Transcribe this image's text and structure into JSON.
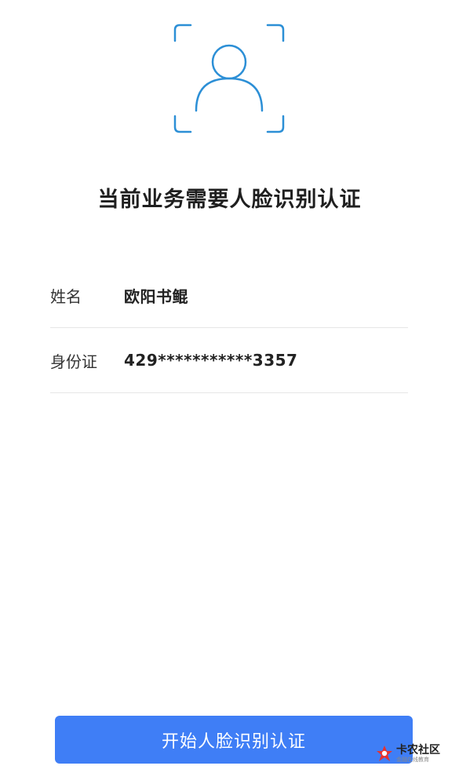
{
  "page": {
    "title": "当前业务需要人脸识别认证"
  },
  "face_icon": {
    "name": "face-scan-icon",
    "color": "#2c8fd6"
  },
  "info": {
    "rows": [
      {
        "label": "姓名",
        "value": "欧阳书鲲"
      },
      {
        "label": "身份证",
        "value": "429***********3357"
      }
    ]
  },
  "action": {
    "start_label": "开始人脸识别认证",
    "color": "#3f7ef6"
  },
  "watermark": {
    "title": "卡农社区",
    "subtitle": "金融在线教育",
    "logo_icon": "kanong-logo-icon"
  }
}
